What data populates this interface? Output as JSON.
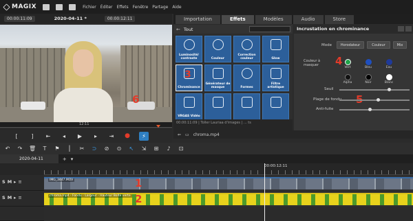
{
  "app": {
    "logo": "MAGIX",
    "menu": [
      "Fichier",
      "Éditer",
      "Effets",
      "Fenêtre",
      "Partage",
      "Aide"
    ]
  },
  "player": {
    "timecode_left": "00:00:11:09",
    "title": "2020-04-11 *",
    "timecode_right": "00:00:12:11",
    "scrub_time": "12:11"
  },
  "annotations": [
    "1",
    "2",
    "3",
    "4",
    "5",
    "6"
  ],
  "tabs": [
    "Importation",
    "Effets",
    "Modèles",
    "Audio",
    "Store"
  ],
  "fx_browser": {
    "heading": "Tout",
    "items": [
      "Luminosité/ contraste",
      "Couleur",
      "Correction couleur",
      "Glow",
      "Chrominance",
      "Générateur de masque",
      "Formes",
      "Filtre artistique",
      "VRGAS Vidéo",
      "",
      "",
      ""
    ],
    "status": "00:00:11:09 | Toller Lauriaa d'images | ... ts"
  },
  "chroma": {
    "title": "Incrustation en chrominance",
    "mode_label": "Mode",
    "modes": [
      "Horodateur",
      "Couleur",
      "Mix"
    ],
    "color_label": "Couleur à masquer",
    "colors": [
      {
        "label": "Vert",
        "hex": "#1fa34a"
      },
      {
        "label": "Bleu",
        "hex": "#1f4fbf"
      },
      {
        "label": "Eau",
        "hex": "#1f3a9a"
      },
      {
        "label": "Alpha",
        "hex": "#111111"
      },
      {
        "label": "Noir",
        "hex": "#000000"
      },
      {
        "label": "Blanc",
        "hex": "#ffffff"
      }
    ],
    "sliders": [
      {
        "label": "Seuil",
        "value": 0.94
      },
      {
        "label": "Plage de fondu",
        "value": 0.88
      },
      {
        "label": "Anti-fuite",
        "value": 0.84
      }
    ]
  },
  "project": {
    "clip_name": "chroma.mp4"
  },
  "timeline": {
    "tab": "2020-04-11",
    "playhead_time": "00:00:12:11",
    "track1_label": "IMG_3447.MOV",
    "track2_label": "chroma.mp4 - Fondu - Largeur - Hauteur Boîte verte"
  }
}
